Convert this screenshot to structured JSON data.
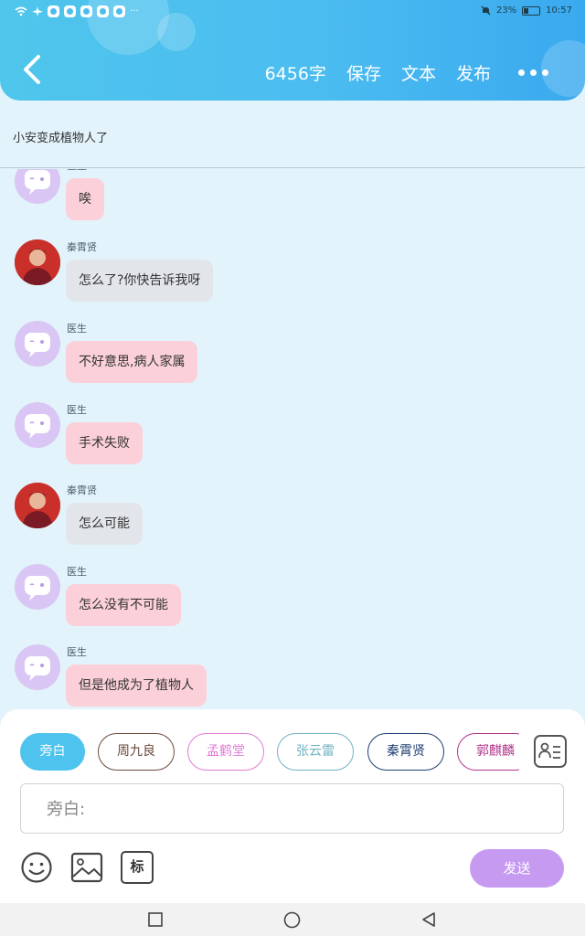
{
  "status_bar": {
    "battery_percent": "23%",
    "time": "10:57",
    "app_badges": [
      "app",
      "app",
      "app",
      "app",
      "app"
    ]
  },
  "header": {
    "word_count": "6456字",
    "save_label": "保存",
    "text_label": "文本",
    "publish_label": "发布",
    "back_icon": "chevron-left-icon",
    "more_icon": "more-dots-icon"
  },
  "title": "小安变成植物人了",
  "messages": [
    {
      "name": "医生",
      "text": "唉",
      "avatar": "doctor",
      "color": "pink"
    },
    {
      "name": "秦霄贤",
      "text": "怎么了?你快告诉我呀",
      "avatar": "person",
      "color": "grey"
    },
    {
      "name": "医生",
      "text": "不好意思,病人家属",
      "avatar": "doctor",
      "color": "pink"
    },
    {
      "name": "医生",
      "text": "手术失败",
      "avatar": "doctor",
      "color": "pink"
    },
    {
      "name": "秦霄贤",
      "text": "怎么可能",
      "avatar": "person",
      "color": "grey"
    },
    {
      "name": "医生",
      "text": "怎么没有不可能",
      "avatar": "doctor",
      "color": "pink"
    },
    {
      "name": "医生",
      "text": "但是他成为了植物人",
      "avatar": "doctor",
      "color": "pink"
    }
  ],
  "roles": [
    {
      "label": "旁白",
      "color": "#4ec3ee",
      "active": true
    },
    {
      "label": "周九良",
      "color": "#6b4a3a",
      "active": false
    },
    {
      "label": "孟鹤堂",
      "color": "#e07bd6",
      "active": false
    },
    {
      "label": "张云雷",
      "color": "#6fb3c0",
      "active": false
    },
    {
      "label": "秦霄贤",
      "color": "#1f3f74",
      "active": false
    },
    {
      "label": "郭麒麟",
      "color": "#b0338a",
      "active": false
    }
  ],
  "input": {
    "placeholder": "旁白:"
  },
  "toolbar": {
    "emoji_icon": "smiley-icon",
    "image_icon": "image-icon",
    "tag_label": "标",
    "send_label": "发送",
    "contact_card_icon": "contact-card-icon"
  },
  "colors": {
    "header_gradient_start": "#4fc6ec",
    "header_gradient_end": "#3aa9ef",
    "page_bg": "#e3f3fb",
    "pink_bubble": "#fbd0d9",
    "grey_bubble": "#e2e6ea",
    "send_button": "#c69af0"
  }
}
